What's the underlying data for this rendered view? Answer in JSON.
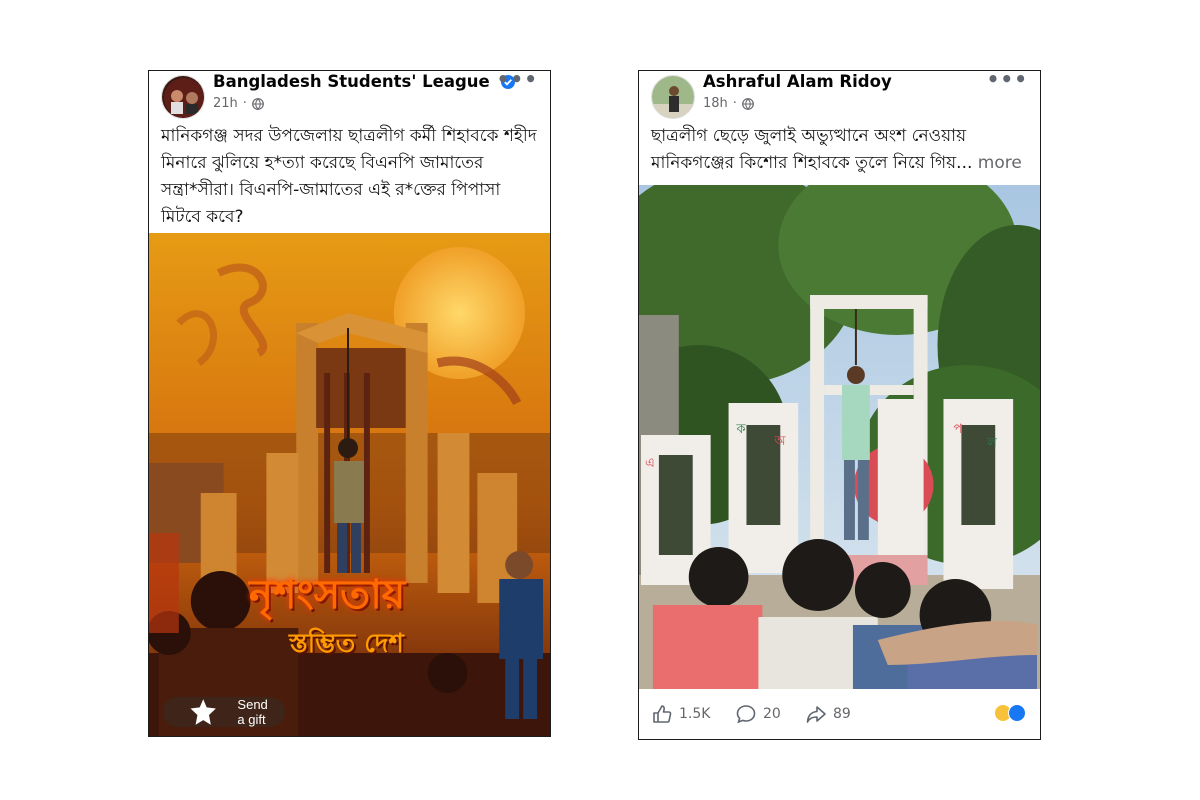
{
  "post_left": {
    "author": "Bangladesh Students' League",
    "time": "21h",
    "menu": "•••",
    "caption": "মানিকগঞ্জ সদর উপজেলায় ছাত্রলীগ কর্মী শিহাবকে শহীদ মিনারে ঝুলিয়ে হ*ত্যা করেছে বিএনপি জামাতের সন্ত্রা*সীরা। বিএনপি-জামাতের এই র*ক্তের পিপাসা মিটবে কবে?",
    "poster_title": "নৃশংসতায়",
    "poster_subtitle": "স্তম্ভিত দেশ",
    "gift_label": "Send a gift",
    "icons": [
      "verified-badge-icon",
      "globe-icon",
      "gift-icon"
    ]
  },
  "post_right": {
    "author": "Ashraful Alam Ridoy",
    "time": "18h",
    "menu": "•••",
    "caption": "ছাত্রলীগ ছেড়ে জুলাই অভ্যুত্থানে অংশ নেওয়ায় মানিকগঞ্জের কিশোর শিহাবকে তুলে নিয়ে গিয়...",
    "see_more": "more",
    "likes": "1.5K",
    "comments": "20",
    "shares": "89",
    "reactions": [
      "sad",
      "like"
    ],
    "icons": [
      "globe-icon",
      "like-icon",
      "comment-icon",
      "share-icon"
    ]
  },
  "colors": {
    "facebook_blue": "#1877f2",
    "meta_gray": "#65676b"
  }
}
